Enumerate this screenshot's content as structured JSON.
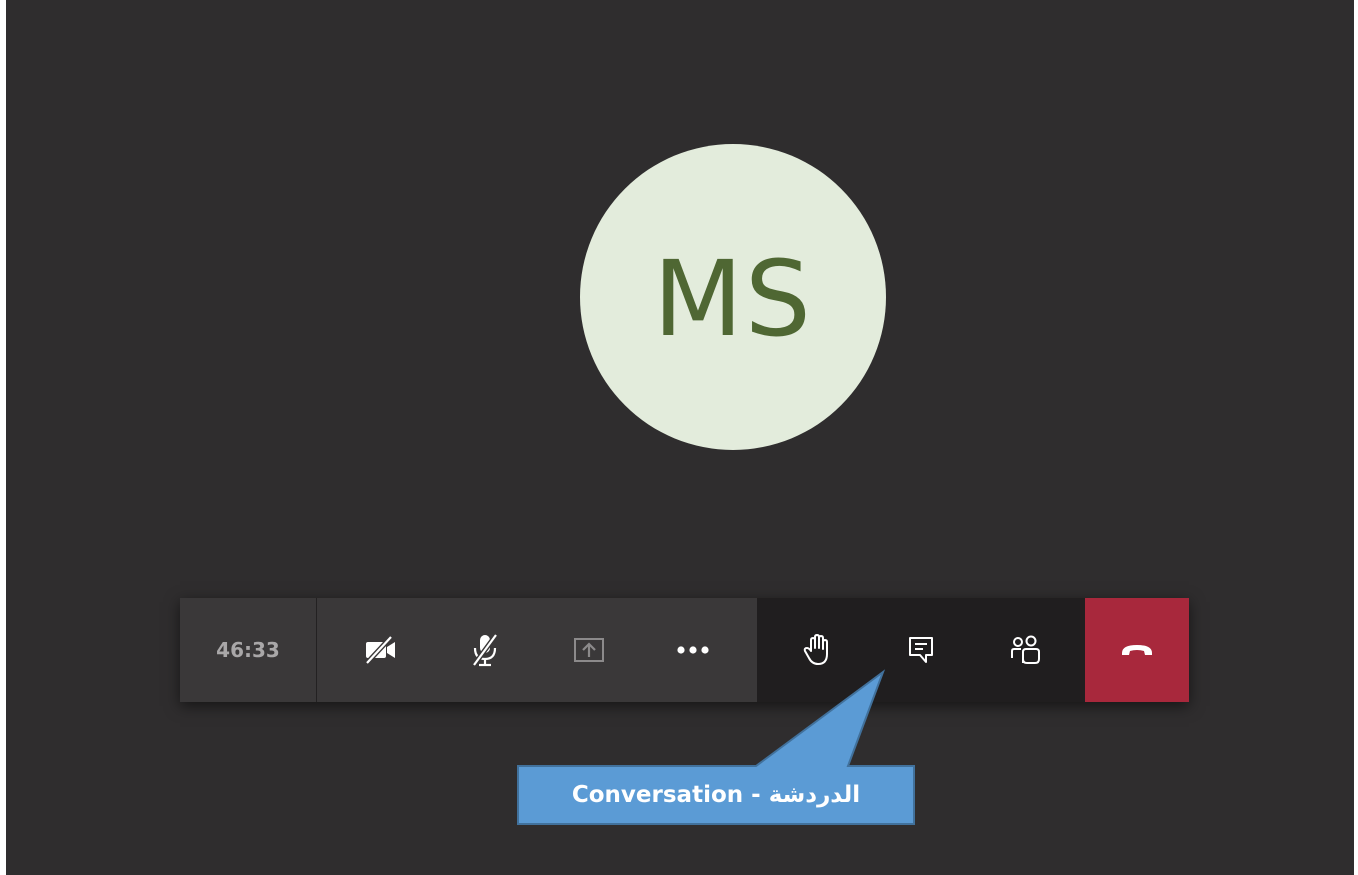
{
  "participant": {
    "initials": "MS",
    "avatar_bg": "#e3ecdc",
    "initials_color": "#4f6733"
  },
  "toolbar": {
    "duration": "46:33",
    "buttons": [
      {
        "name": "camera-off",
        "icon": "video-off-icon"
      },
      {
        "name": "mic-off",
        "icon": "mic-off-icon"
      },
      {
        "name": "share-screen",
        "icon": "share-tray-icon"
      },
      {
        "name": "more-actions",
        "icon": "ellipsis-icon"
      },
      {
        "name": "raise-hand",
        "icon": "hand-icon"
      },
      {
        "name": "show-conversation",
        "icon": "chat-icon"
      },
      {
        "name": "show-participants",
        "icon": "people-icon"
      },
      {
        "name": "hang-up",
        "icon": "phone-hangup-icon"
      }
    ],
    "hangup_color": "#a8283c"
  },
  "callout": {
    "text": "الدردشة - Conversation",
    "fill": "#5b9bd5",
    "stroke": "#41719c"
  }
}
